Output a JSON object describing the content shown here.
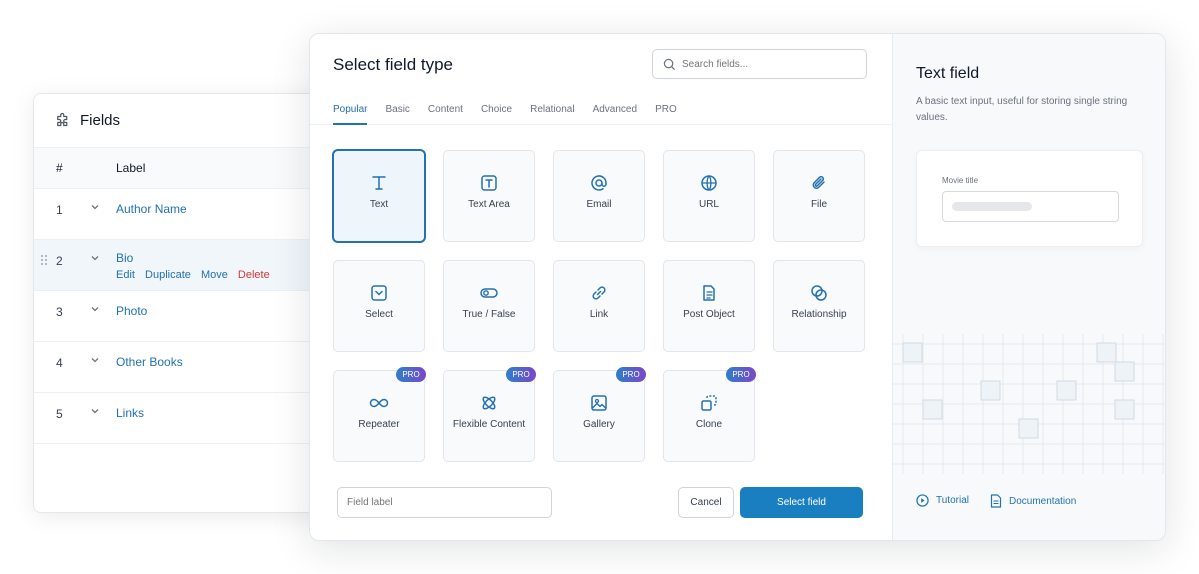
{
  "fields_panel": {
    "title": "Fields",
    "col_num": "#",
    "col_label": "Label",
    "rows": [
      {
        "num": "1",
        "label": "Author Name"
      },
      {
        "num": "2",
        "label": "Bio"
      },
      {
        "num": "3",
        "label": "Photo"
      },
      {
        "num": "4",
        "label": "Other Books"
      },
      {
        "num": "5",
        "label": "Links"
      }
    ],
    "row_actions": {
      "edit": "Edit",
      "duplicate": "Duplicate",
      "move": "Move",
      "delete": "Delete"
    }
  },
  "modal": {
    "title": "Select field type",
    "search_placeholder": "Search fields...",
    "tabs": [
      "Popular",
      "Basic",
      "Content",
      "Choice",
      "Relational",
      "Advanced",
      "PRO"
    ],
    "active_tab": "Popular",
    "field_types": [
      {
        "label": "Text",
        "icon": "text-icon",
        "selected": true
      },
      {
        "label": "Text Area",
        "icon": "textarea-icon"
      },
      {
        "label": "Email",
        "icon": "at-icon"
      },
      {
        "label": "URL",
        "icon": "globe-icon"
      },
      {
        "label": "File",
        "icon": "paperclip-icon"
      },
      {
        "label": "Select",
        "icon": "select-icon"
      },
      {
        "label": "True / False",
        "icon": "toggle-icon"
      },
      {
        "label": "Link",
        "icon": "link-icon"
      },
      {
        "label": "Post Object",
        "icon": "document-icon"
      },
      {
        "label": "Relationship",
        "icon": "relationship-icon"
      },
      {
        "label": "Repeater",
        "icon": "infinity-icon",
        "pro": "PRO"
      },
      {
        "label": "Flexible Content",
        "icon": "flexible-icon",
        "pro": "PRO"
      },
      {
        "label": "Gallery",
        "icon": "image-icon",
        "pro": "PRO"
      },
      {
        "label": "Clone",
        "icon": "clone-icon",
        "pro": "PRO"
      }
    ],
    "field_label_placeholder": "Field label",
    "cancel_label": "Cancel",
    "select_label": "Select field"
  },
  "detail": {
    "title": "Text field",
    "description": "A basic text input, useful for storing single string values.",
    "preview_label": "Movie title",
    "tutorial_label": "Tutorial",
    "documentation_label": "Documentation"
  },
  "colors": {
    "accent": "#2271b1",
    "primary_button": "#1a7fc1",
    "delete": "#d63638"
  }
}
